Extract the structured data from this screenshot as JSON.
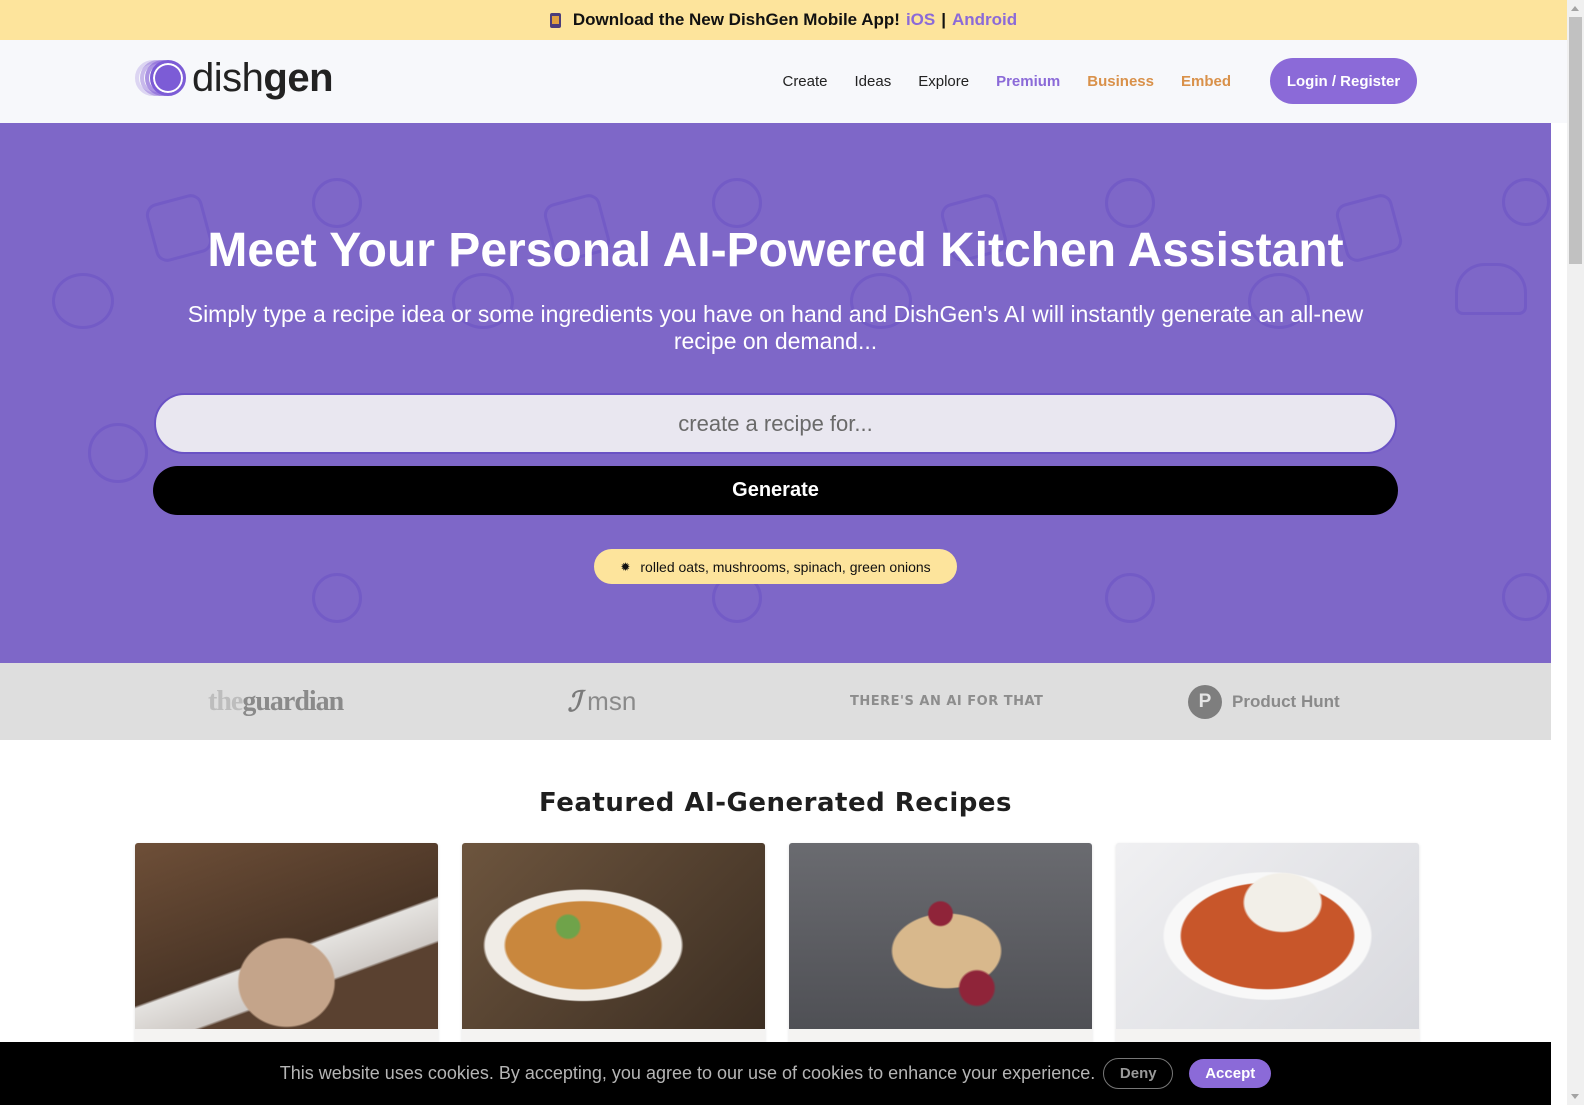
{
  "announcement": {
    "text": "Download the New DishGen Mobile App!",
    "ios_link": "iOS",
    "separator": "|",
    "android_link": "Android"
  },
  "header": {
    "logo_light": "dish",
    "logo_bold": "gen",
    "nav": [
      {
        "label": "Create"
      },
      {
        "label": "Ideas"
      },
      {
        "label": "Explore"
      },
      {
        "label": "Premium"
      },
      {
        "label": "Business"
      },
      {
        "label": "Embed"
      }
    ],
    "login_label": "Login / Register"
  },
  "hero": {
    "title": "Meet Your Personal AI-Powered Kitchen Assistant",
    "subtitle": "Simply type a recipe idea or some ingredients you have on hand and DishGen's AI will instantly generate an all-new recipe on demand...",
    "search_placeholder": "create a recipe for...",
    "search_value": "",
    "generate_label": "Generate",
    "suggestion_icon": "bulb-icon",
    "suggestion": "rolled oats, mushrooms, spinach, green onions"
  },
  "press": {
    "guardian_the": "the",
    "guardian_name": "guardian",
    "msn": "msn",
    "aiforthat": "THERE'S AN AI FOR THAT",
    "producthunt_letter": "P",
    "producthunt": "Product Hunt"
  },
  "featured": {
    "title": "Featured AI-Generated Recipes",
    "cards": [
      {
        "image": "cookies-stack"
      },
      {
        "image": "lentil-dal-bowl"
      },
      {
        "image": "jam-thumbprint-cookies"
      },
      {
        "image": "chickpea-stew-with-rice"
      }
    ]
  },
  "cookie": {
    "message": "This website uses cookies. By accepting, you agree to our use of cookies to enhance your experience.",
    "deny_label": "Deny",
    "accept_label": "Accept"
  },
  "colors": {
    "brand_purple": "#8b6ad8",
    "hero_purple": "#7e67c8",
    "announce_yellow": "#fde49c",
    "accent_orange": "#d9914a"
  }
}
